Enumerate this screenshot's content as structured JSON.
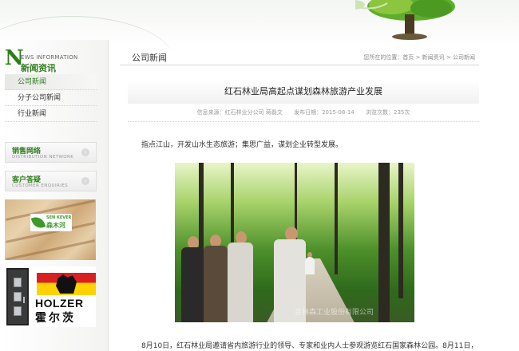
{
  "sidebar": {
    "section_en": "EWS INFORMATION",
    "section_letter": "N",
    "section_cn": "新闻资讯",
    "menu": [
      {
        "label": "公司新闻",
        "active": true
      },
      {
        "label": "分子公司新闻",
        "active": false
      },
      {
        "label": "行业新闻",
        "active": false
      }
    ],
    "boxes": [
      {
        "cn": "销售网络",
        "en": "DISTRIBUTION NETWORK"
      },
      {
        "cn": "客户答疑",
        "en": "CUSTOMER ENQUIRIES"
      }
    ],
    "ads": {
      "ad1_brand_en": "SEN KEVER",
      "ad1_brand_cn": "森木河",
      "ad2_brand_en": "HOLZER",
      "ad2_brand_cn": "霍尔茨"
    }
  },
  "main": {
    "header_title": "公司新闻",
    "breadcrumb": {
      "prefix": "您所在的位置：",
      "home": "首页",
      "sep": " > ",
      "level1": "新闻资讯",
      "level2": "公司新闻"
    },
    "article": {
      "title": "红石林业局高起点谋划森林旅游产业发展",
      "meta_source": "信息来源：红石林业分公司 蒋磊文",
      "meta_date": "发布日期：2015-08-14",
      "meta_views": "浏览次数：235次",
      "lead": "指点江山，开发山水生态旅游；集思广益，谋划企业转型发展。",
      "photo_watermark": "吉林森工业股份有限公司",
      "paragraph": "8月10日，红石林业局邀请省内旅游行业的领导、专家和业内人士参观游览红石国家森林公园。8月11日，"
    }
  },
  "colors": {
    "brand_green": "#2e7d1c",
    "text": "#333333",
    "muted": "#999999"
  }
}
